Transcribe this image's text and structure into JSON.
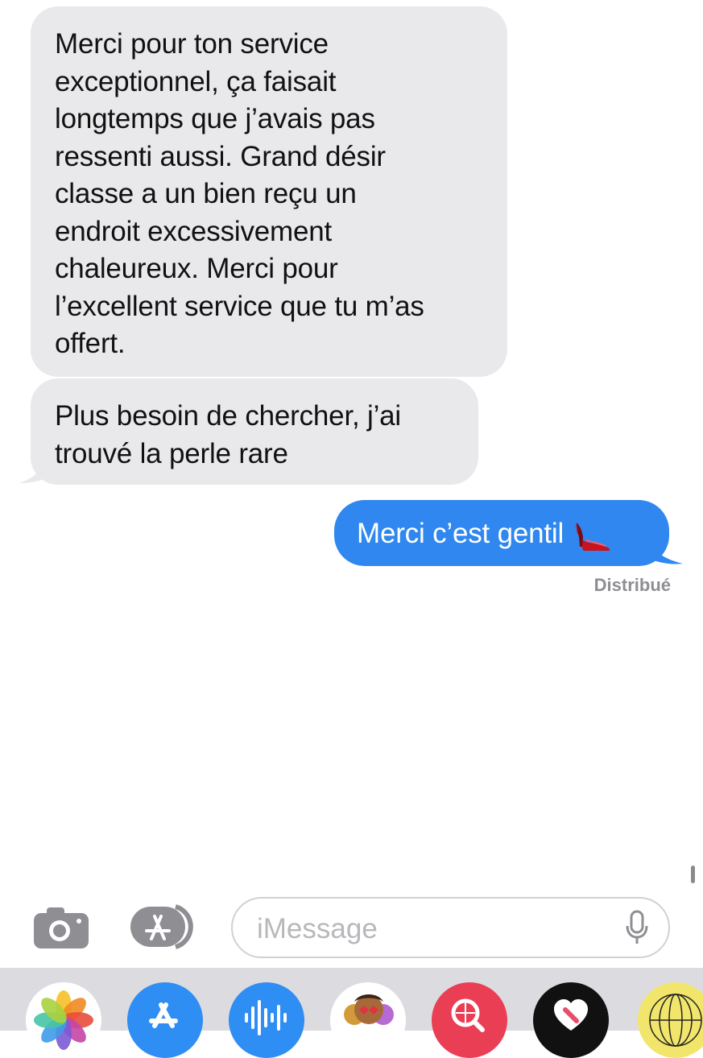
{
  "messages": [
    {
      "direction": "received",
      "text": "Merci pour ton service\nexceptionnel, ça faisait\nlongtemps que j’avais pas\nressenti aussi. Grand désir\nclasse a un bien reçu un\nendroit excessivement\nchaleureux. Merci pour\nl’excellent service que tu m’as\noffert."
    },
    {
      "direction": "received",
      "text": "Plus besoin de chercher, j’ai\ntrouvé la perle rare"
    },
    {
      "direction": "sent",
      "text": "Merci c’est gentil",
      "emoji": "high-heel"
    }
  ],
  "status": "Distribué",
  "compose": {
    "placeholder": "iMessage",
    "value": ""
  },
  "app_drawer": [
    "photos",
    "app-store",
    "audio-messages",
    "memoji",
    "image-search",
    "fitness",
    "other-app"
  ],
  "colors": {
    "received_bubble": "#e9e9eb",
    "sent_bubble": "#2f87ef",
    "status_text": "#8e8e93"
  }
}
